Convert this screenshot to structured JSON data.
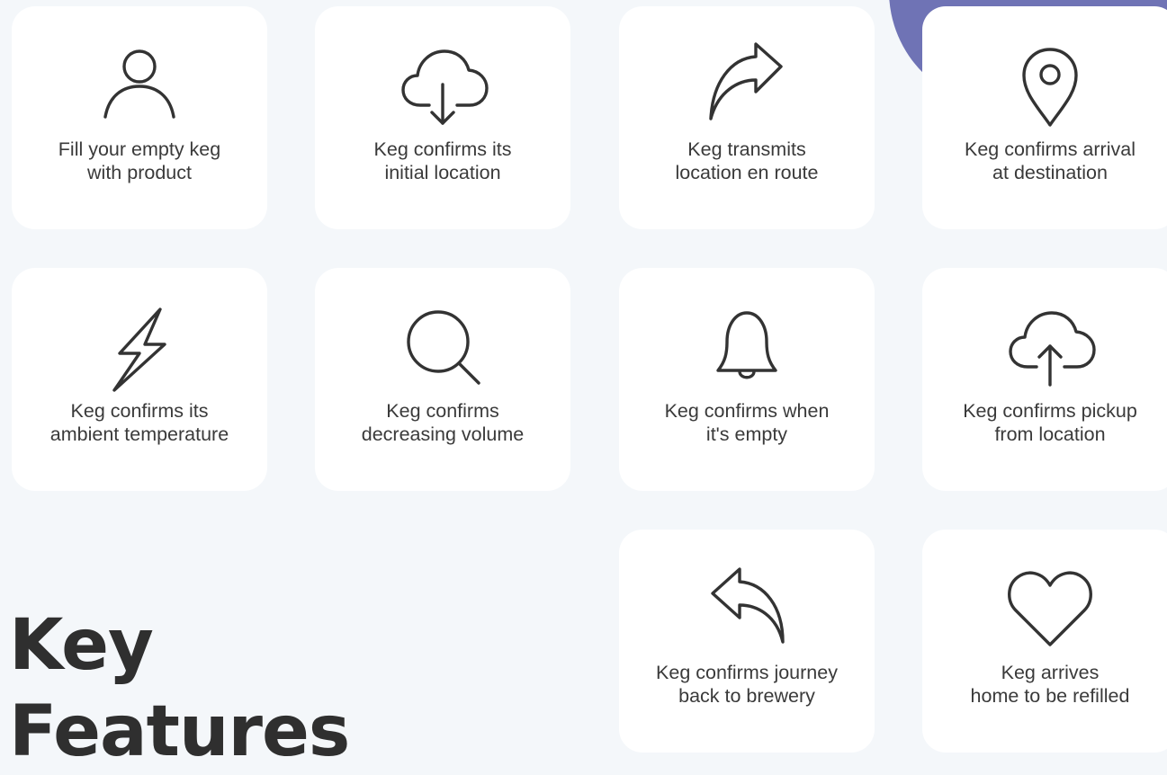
{
  "section": {
    "title_lines": [
      "Key",
      "Features"
    ]
  },
  "features": [
    {
      "icon": "user-icon",
      "lines": [
        "Fill your empty keg",
        "with product"
      ]
    },
    {
      "icon": "cloud-download-icon",
      "lines": [
        "Keg confirms its",
        "initial location"
      ]
    },
    {
      "icon": "share-arrow-icon",
      "lines": [
        "Keg transmits",
        "location en route"
      ]
    },
    {
      "icon": "map-pin-icon",
      "lines": [
        "Keg confirms arrival",
        "at destination"
      ]
    },
    {
      "icon": "lightning-bolt-icon",
      "lines": [
        "Keg confirms its",
        "ambient temperature"
      ]
    },
    {
      "icon": "search-icon",
      "lines": [
        "Keg confirms",
        "decreasing volume"
      ]
    },
    {
      "icon": "bell-icon",
      "lines": [
        "Keg confirms when",
        "it's empty"
      ]
    },
    {
      "icon": "cloud-upload-icon",
      "lines": [
        "Keg confirms pickup",
        "from location"
      ]
    },
    {
      "icon": "reply-arrow-icon",
      "lines": [
        "Keg confirms journey",
        "back to brewery"
      ]
    },
    {
      "icon": "heart-icon",
      "lines": [
        "Keg arrives",
        "home to be refilled"
      ]
    }
  ],
  "colors": {
    "background": "#f4f7fa",
    "card": "#ffffff",
    "accent_blob": "#6f73b5",
    "icon_stroke": "#333333",
    "text": "#333333"
  }
}
